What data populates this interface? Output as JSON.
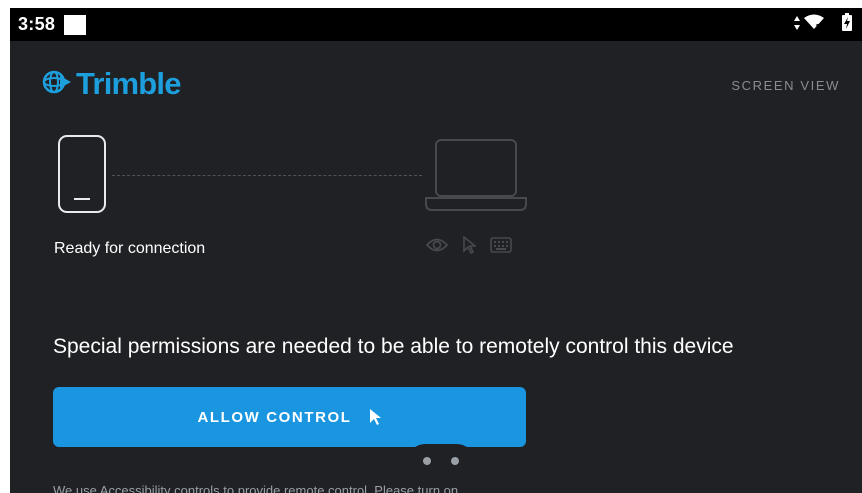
{
  "status_bar": {
    "time": "3:58",
    "icons": [
      "data-arrows-icon",
      "wifi-icon",
      "battery-charging-icon"
    ]
  },
  "header": {
    "logo_text": "Trimble",
    "screen_view_label": "SCREEN VIEW"
  },
  "connection": {
    "status_text": "Ready for connection",
    "capability_icons": [
      "eye-icon",
      "pointer-icon",
      "keyboard-icon"
    ]
  },
  "permissions": {
    "message": "Special permissions are needed to be able to remotely control this device",
    "button_label": "ALLOW CONTROL",
    "footnote": "We use Accessibility controls to provide remote control. Please turn on"
  },
  "pager": {
    "page_count": 2
  },
  "colors": {
    "background": "#202124",
    "accent": "#1a95e0",
    "logo": "#1e9fdd",
    "muted": "#8a8c8f"
  }
}
